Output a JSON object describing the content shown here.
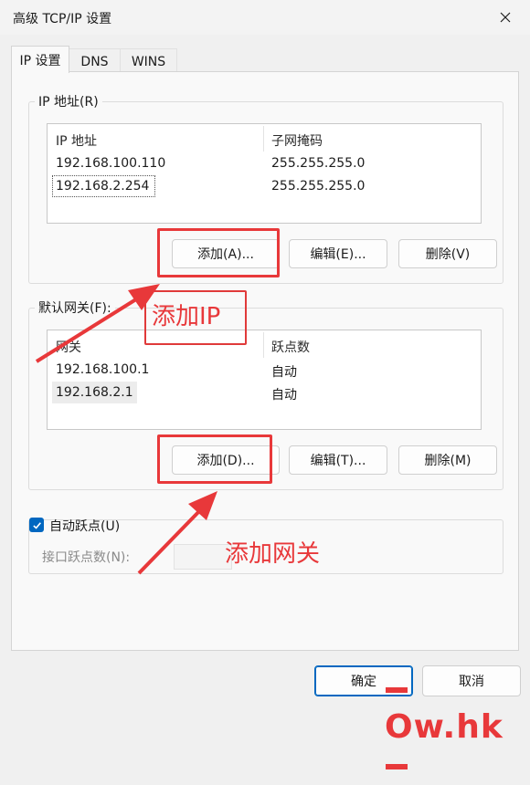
{
  "window": {
    "title": "高级 TCP/IP 设置",
    "close_icon": "close-icon"
  },
  "tabs": [
    {
      "label": "IP 设置",
      "selected": true
    },
    {
      "label": "DNS",
      "selected": false
    },
    {
      "label": "WINS",
      "selected": false
    }
  ],
  "ip_group": {
    "label": "IP 地址(R)",
    "columns": [
      "IP 地址",
      "子网掩码"
    ],
    "rows": [
      {
        "ip": "192.168.100.110",
        "mask": "255.255.255.0"
      },
      {
        "ip": "192.168.2.254",
        "mask": "255.255.255.0"
      }
    ],
    "add_label": "添加(A)...",
    "edit_label": "编辑(E)...",
    "delete_label": "删除(V)"
  },
  "gateway_group": {
    "label": "默认网关(F):",
    "columns": [
      "网关",
      "跃点数"
    ],
    "rows": [
      {
        "gateway": "192.168.100.1",
        "metric": "自动"
      },
      {
        "gateway": "192.168.2.1",
        "metric": "自动"
      }
    ],
    "add_label": "添加(D)...",
    "edit_label": "编辑(T)...",
    "delete_label": "删除(M)"
  },
  "metric": {
    "auto_label": "自动跃点(U)",
    "auto_checked": true,
    "interface_label": "接口跃点数(N):",
    "interface_value": ""
  },
  "footer": {
    "ok_label": "确定",
    "cancel_label": "取消"
  },
  "annotations": {
    "add_ip": "添加IP",
    "add_gateway": "添加网关",
    "color": "#e8383a"
  },
  "watermark": {
    "text": "Ow.hk"
  },
  "colors": {
    "accent": "#0067c0",
    "background": "#f0f0f0",
    "panel": "#f9f9f9"
  }
}
